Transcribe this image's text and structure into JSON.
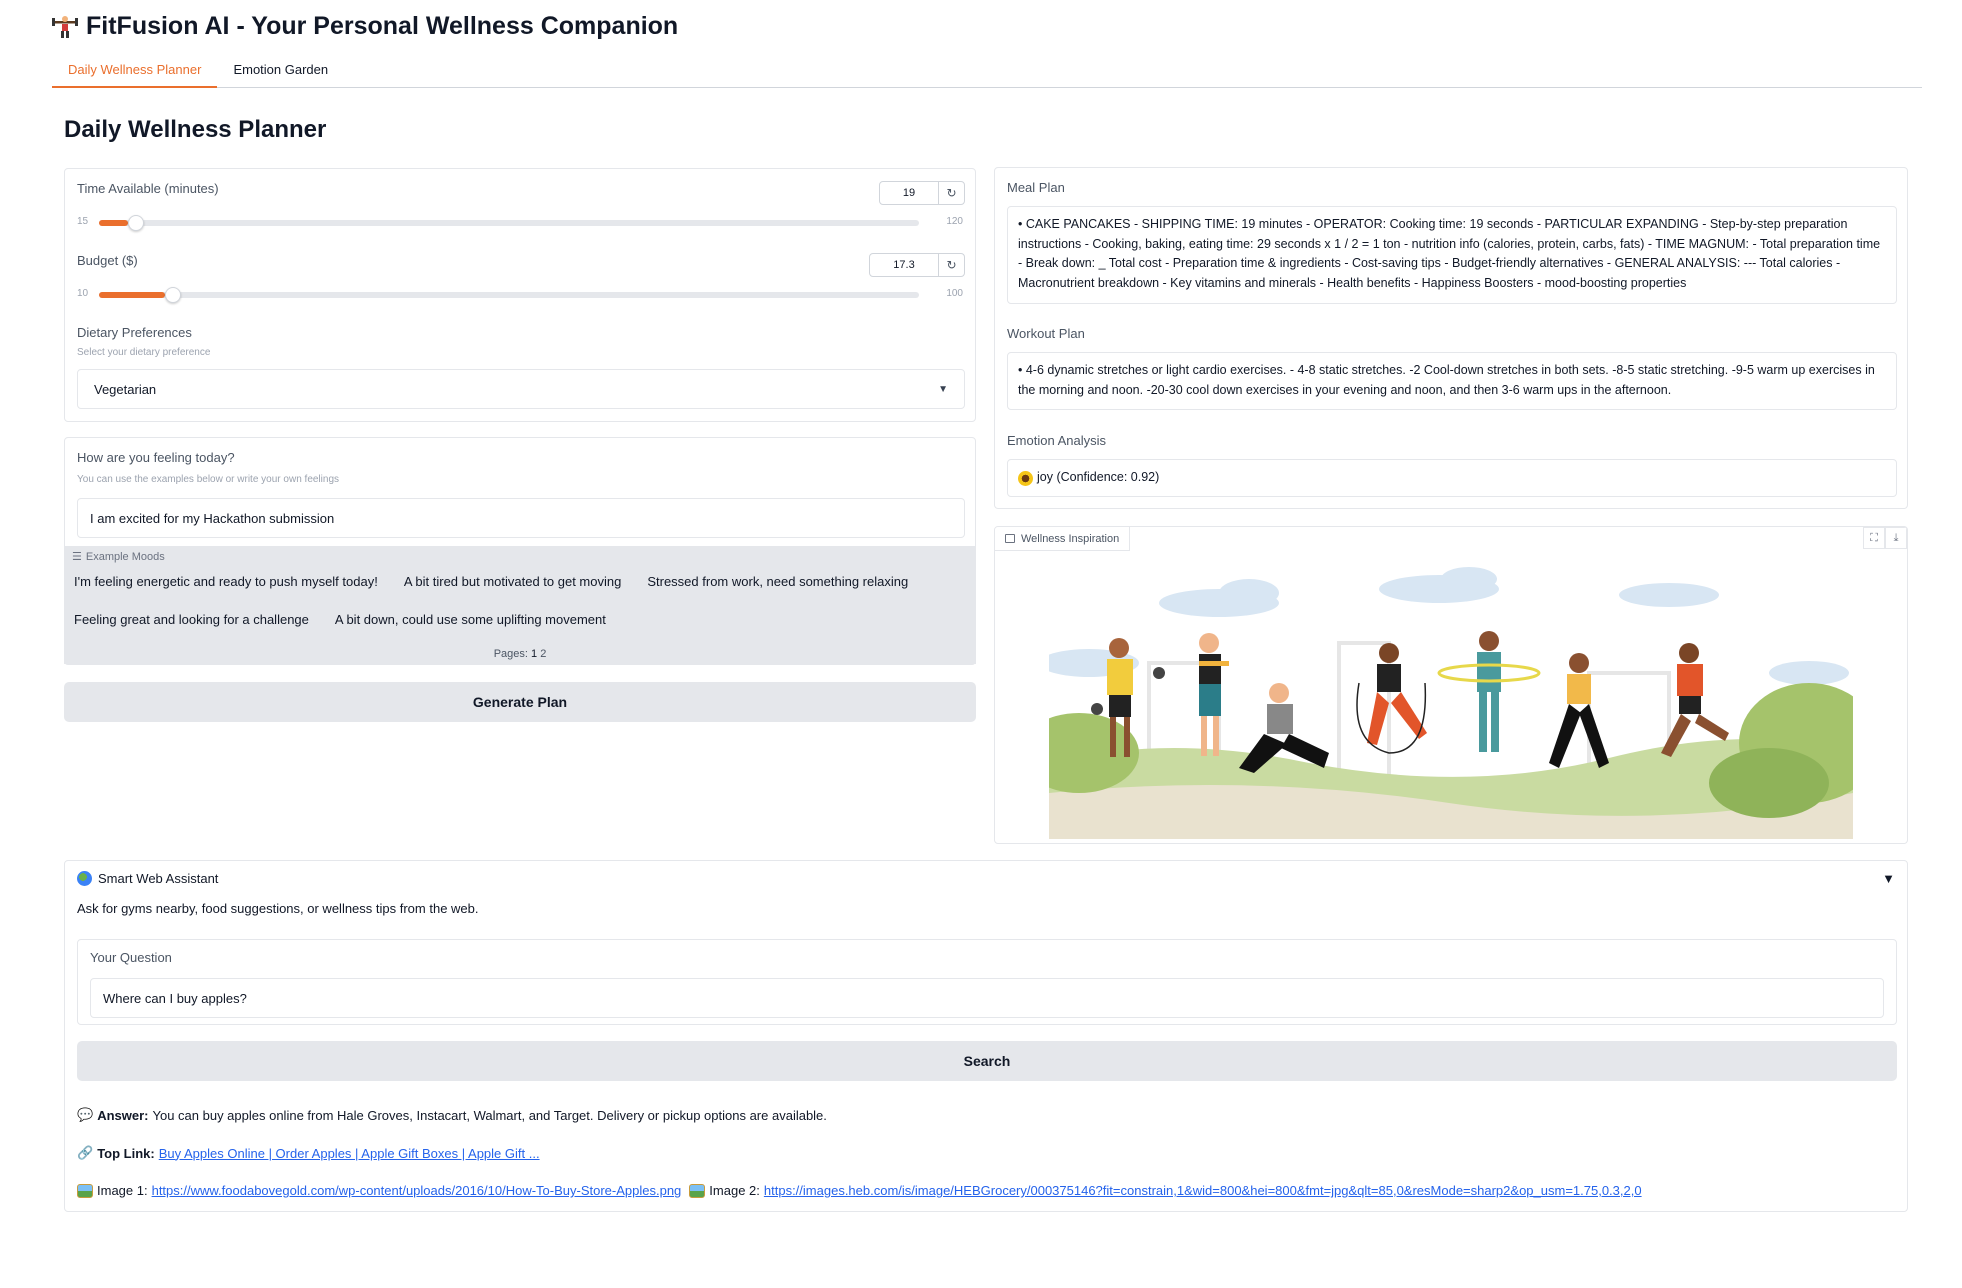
{
  "app": {
    "title": "FitFusion AI - Your Personal Wellness Companion"
  },
  "tabs": [
    {
      "label": "Daily Wellness Planner",
      "active": true
    },
    {
      "label": "Emotion Garden",
      "active": false
    }
  ],
  "planner": {
    "heading": "Daily Wellness Planner",
    "time": {
      "label": "Time Available (minutes)",
      "value": "19",
      "min": "15",
      "max": "120",
      "fraction": 0.035
    },
    "budget": {
      "label": "Budget ($)",
      "value": "17.3",
      "min": "10",
      "max": "100",
      "fraction": 0.081
    },
    "diet": {
      "label": "Dietary Preferences",
      "hint": "Select your dietary preference",
      "selected": "Vegetarian"
    },
    "feeling": {
      "label": "How are you feeling today?",
      "hint": "You can use the examples below or write your own feelings",
      "value": "I am excited for my Hackathon submission"
    },
    "examples": {
      "label": "Example Moods",
      "row1": [
        "I'm feeling energetic and ready to push myself today!",
        "A bit tired but motivated to get moving",
        "Stressed from work, need something relaxing"
      ],
      "row2": [
        "Feeling great and looking for a challenge",
        "A bit down, could use some uplifting movement"
      ],
      "pages_label": "Pages:",
      "pages": [
        "1",
        "2"
      ]
    },
    "generate_label": "Generate Plan"
  },
  "outputs": {
    "meal": {
      "label": "Meal Plan",
      "text": "• CAKE PANCAKES - SHIPPING TIME: 19 minutes - OPERATOR: Cooking time: 19 seconds - PARTICULAR EXPANDING - Step-by-step preparation instructions - Cooking, baking, eating time: 29 seconds x 1 / 2 = 1 ton - nutrition info (calories, protein, carbs, fats) - TIME MAGNUM: - Total preparation time - Break down: _ Total cost - Preparation time & ingredients - Cost-saving tips - Budget-friendly alternatives - GENERAL ANALYSIS: --- Total calories - Macronutrient breakdown - Key vitamins and minerals - Health benefits - Happiness Boosters - mood-boosting properties"
    },
    "workout": {
      "label": "Workout Plan",
      "text": "• 4-6 dynamic stretches or light cardio exercises. - 4-8 static stretches. -2 Cool-down stretches in both sets. -8-5 static stretching. -9-5 warm up exercises in the morning and noon. -20-30 cool down exercises in your evening and noon, and then 3-6 warm ups in the afternoon."
    },
    "emotion": {
      "label": "Emotion Analysis",
      "text": "joy (Confidence: 0.92)",
      "icon": "sunflower-icon"
    },
    "image": {
      "label": "Wellness Inspiration"
    }
  },
  "assistant": {
    "title": "Smart Web Assistant",
    "description": "Ask for gyms nearby, food suggestions, or wellness tips from the web.",
    "question_label": "Your Question",
    "question_value": "Where can I buy apples?",
    "search_label": "Search",
    "answer_label": "Answer:",
    "answer_text": "You can buy apples online from Hale Groves, Instacart, Walmart, and Target. Delivery or pickup options are available.",
    "toplink_label": "Top Link:",
    "toplink_text": "Buy Apples Online | Order Apples | Apple Gift Boxes | Apple Gift ...",
    "image1_label": "Image 1:",
    "image1_url": "https://www.foodabovegold.com/wp-content/uploads/2016/10/How-To-Buy-Store-Apples.png",
    "image2_label": "Image 2:",
    "image2_url": "https://images.heb.com/is/image/HEBGrocery/000375146?fit=constrain,1&wid=800&hei=800&fmt=jpg&qlt=85,0&resMode=sharp2&op_usm=1.75,0.3,2,0"
  },
  "colors": {
    "accent": "#ea6f2d",
    "button_bg": "#e5e7eb",
    "link": "#2563eb"
  }
}
